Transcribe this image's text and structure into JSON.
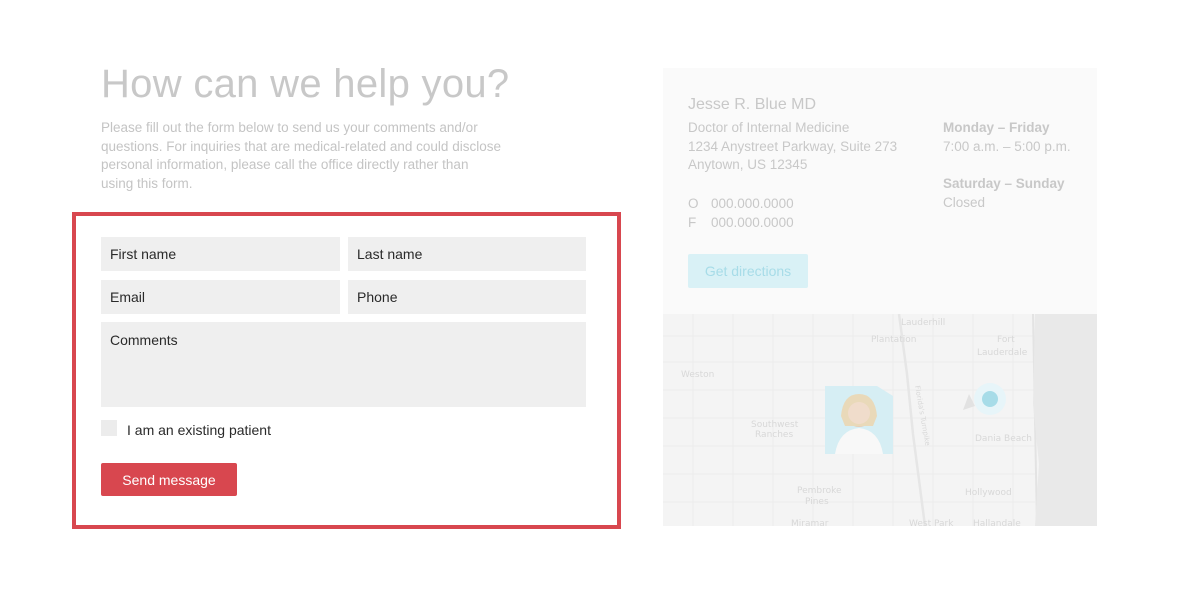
{
  "heading": "How can we help you?",
  "intro": "Please fill out the form below to send us your comments and/or questions. For inquiries that are medical-related and could disclose personal information, please call the office directly rather than using this form.",
  "form": {
    "first_name_placeholder": "First name",
    "last_name_placeholder": "Last name",
    "email_placeholder": "Email",
    "phone_placeholder": "Phone",
    "comments_placeholder": "Comments",
    "existing_patient_label": "I am an existing patient",
    "send_label": "Send message"
  },
  "doctor": {
    "name": "Jesse R. Blue MD",
    "title": "Doctor of Internal Medicine",
    "address_line1": "1234 Anystreet Parkway, Suite 273",
    "address_line2": "Anytown, US 12345",
    "office_prefix": "O",
    "office_phone": "000.000.0000",
    "fax_prefix": "F",
    "fax": "000.000.0000",
    "weekday_label": "Monday – Friday",
    "weekday_hours": "7:00 a.m. – 5:00 p.m.",
    "weekend_label": "Saturday – Sunday",
    "weekend_hours": "Closed",
    "directions_label": "Get directions"
  },
  "map": {
    "places": [
      "Lauderhill",
      "Plantation",
      "Fort",
      "Lauderdale",
      "Weston",
      "Southwest",
      "Ranches",
      "Dania Beach",
      "Pembroke",
      "Pines",
      "Hollywood",
      "Miramar",
      "West Park",
      "Hallandale"
    ],
    "road_label": "Florida's Turnpike",
    "ocean_color": "#e9e9e9",
    "pin_color": "#a7dce8"
  },
  "colors": {
    "accent": "#d8474f",
    "muted_text": "#c8c8c8"
  }
}
